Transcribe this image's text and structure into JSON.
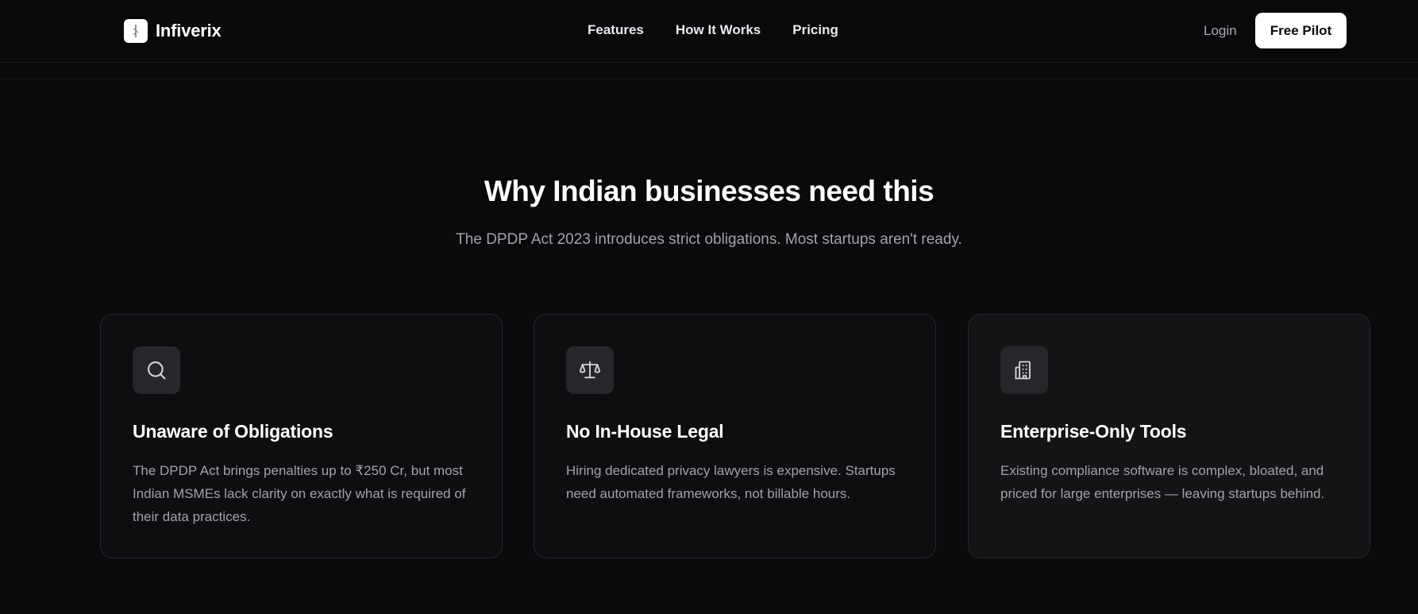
{
  "header": {
    "brand_name": "Infiverix",
    "nav": [
      "Features",
      "How It Works",
      "Pricing"
    ],
    "login_label": "Login",
    "cta_label": "Free Pilot"
  },
  "section": {
    "title": "Why Indian businesses need this",
    "subtitle": "The DPDP Act 2023 introduces strict obligations. Most startups aren't ready."
  },
  "cards": [
    {
      "icon": "search-icon",
      "title": "Unaware of Obligations",
      "text": "The DPDP Act brings penalties up to ₹250 Cr, but most Indian MSMEs lack clarity on exactly what is required of their data practices."
    },
    {
      "icon": "scale-icon",
      "title": "No In-House Legal",
      "text": "Hiring dedicated privacy lawyers is expensive. Startups need automated frameworks, not billable hours."
    },
    {
      "icon": "building-icon",
      "title": "Enterprise-Only Tools",
      "text": "Existing compliance software is complex, bloated, and priced for large enterprises — leaving startups behind."
    }
  ],
  "colors": {
    "background": "#0a0a0c",
    "card_background": "#0e0e11",
    "card_border": "#26262b",
    "muted_text": "#a1a1aa",
    "cta_background": "#ffffff"
  }
}
